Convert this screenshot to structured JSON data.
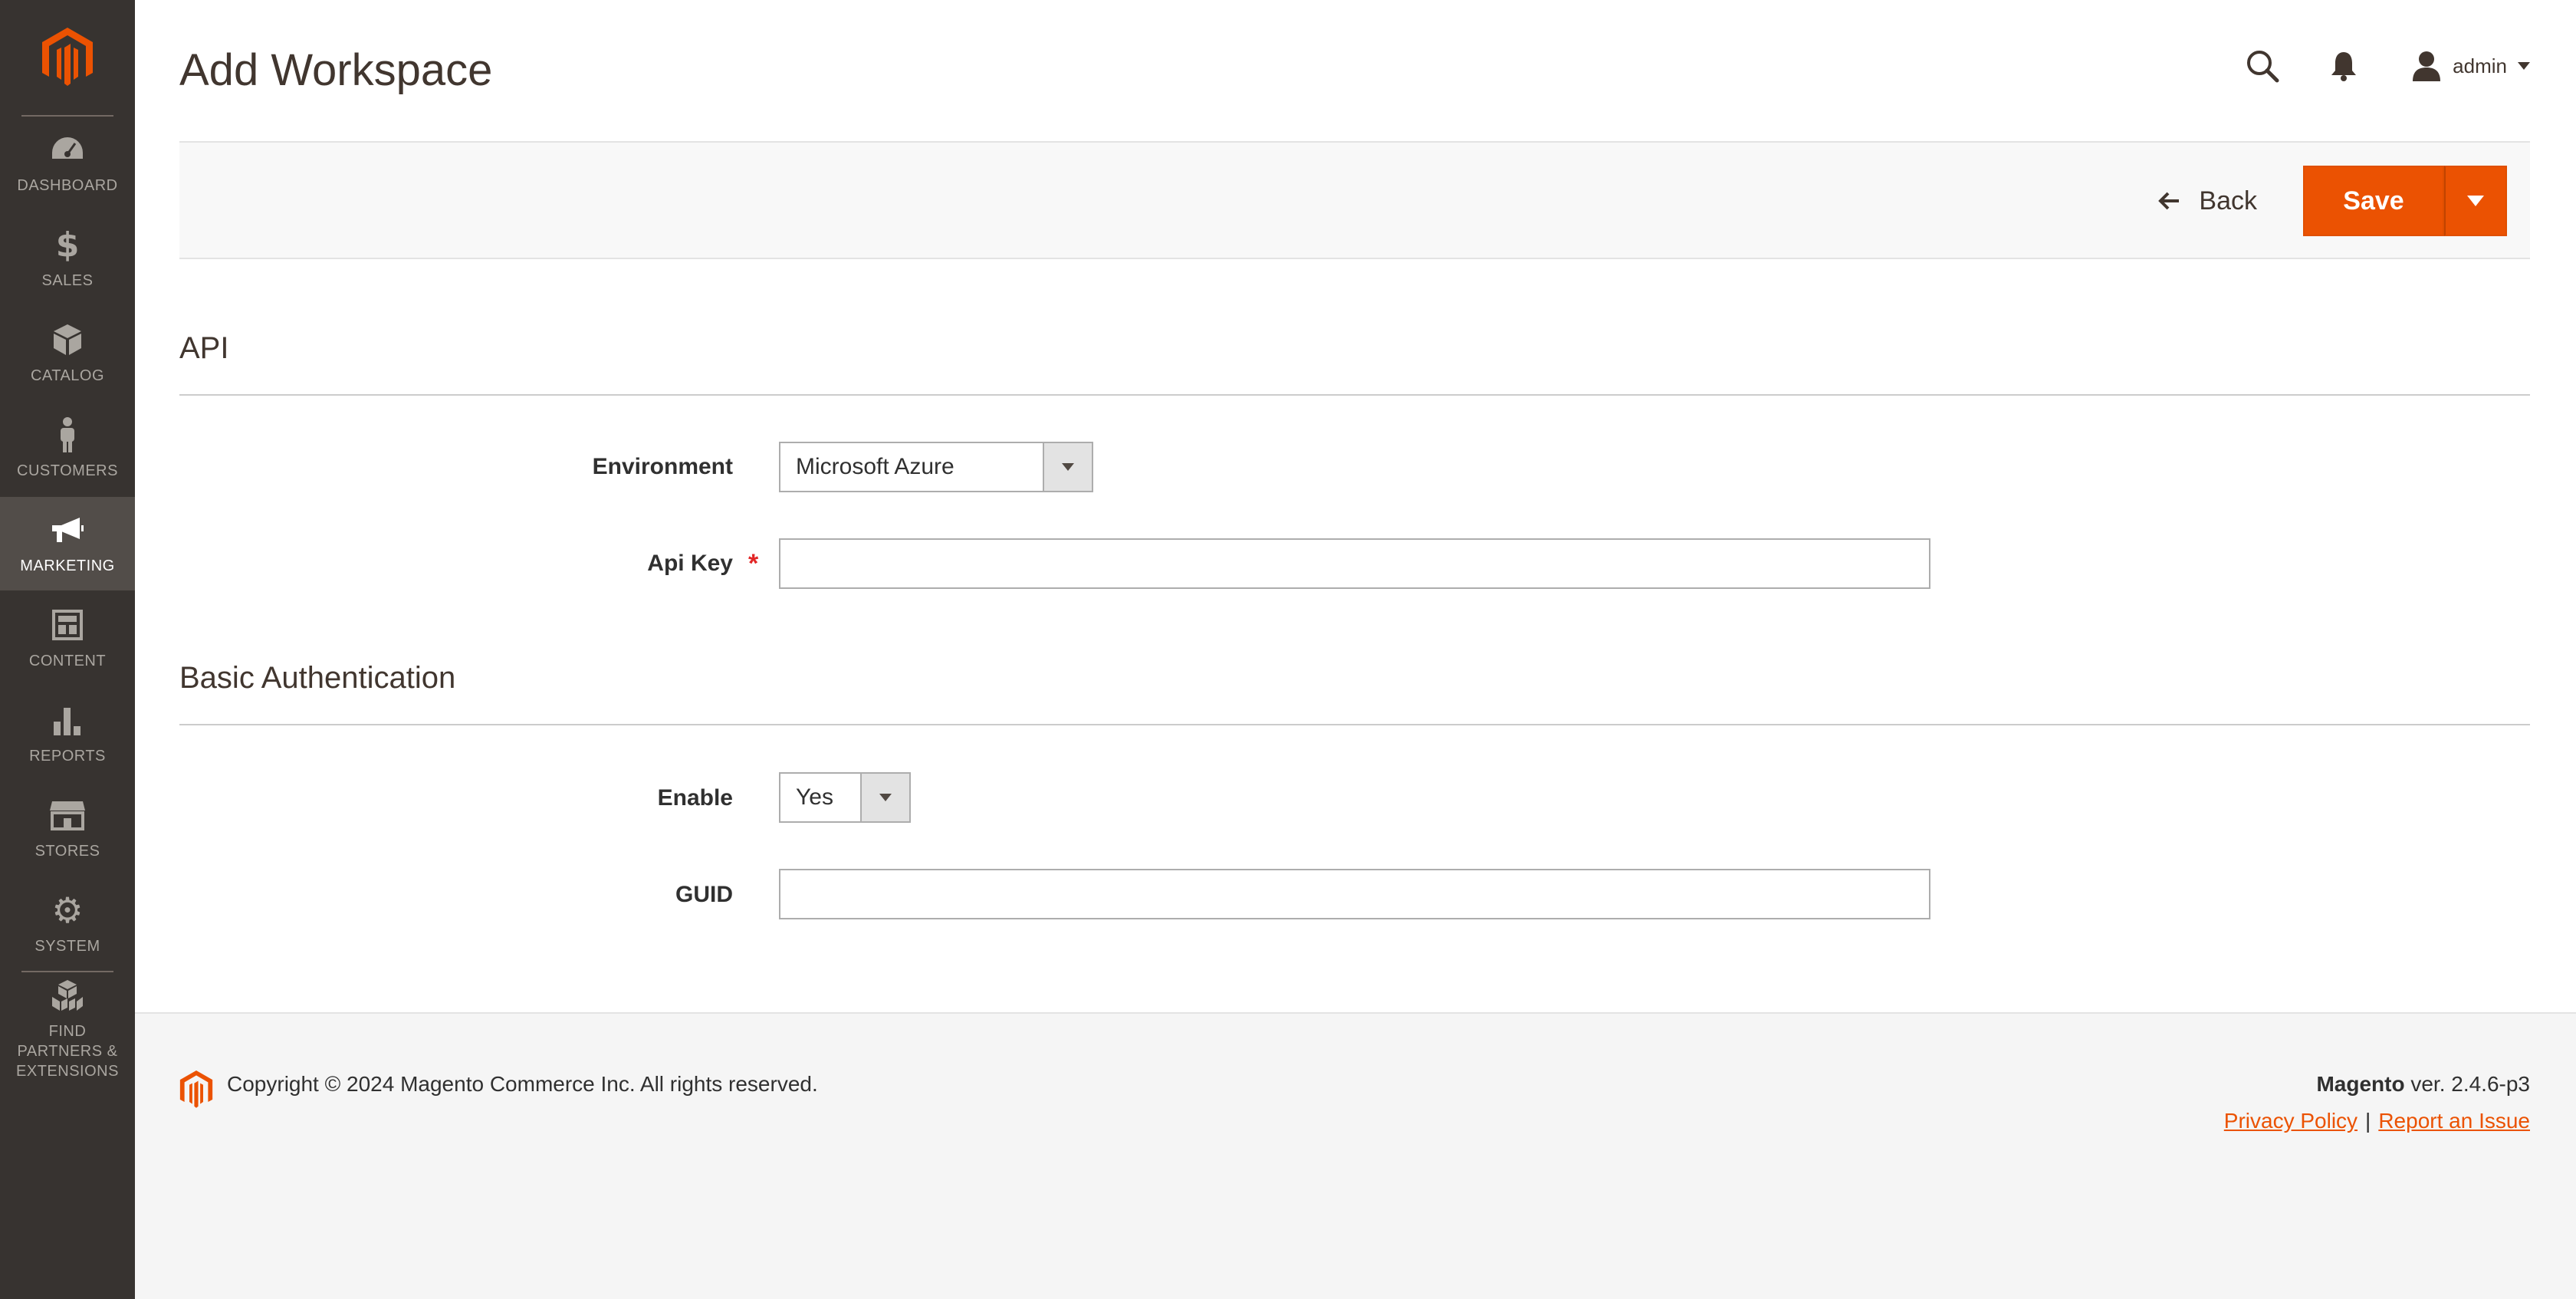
{
  "app": {
    "brand_color": "#eb5202"
  },
  "sidebar": {
    "items": [
      {
        "label": "DASHBOARD",
        "icon": "dashboard-gauge-icon"
      },
      {
        "label": "SALES",
        "icon": "dollar-icon"
      },
      {
        "label": "CATALOG",
        "icon": "box-icon"
      },
      {
        "label": "CUSTOMERS",
        "icon": "person-icon"
      },
      {
        "label": "MARKETING",
        "icon": "megaphone-icon",
        "active": true
      },
      {
        "label": "CONTENT",
        "icon": "layout-icon"
      },
      {
        "label": "REPORTS",
        "icon": "bar-chart-icon"
      },
      {
        "label": "STORES",
        "icon": "storefront-icon"
      },
      {
        "label": "SYSTEM",
        "icon": "gear-icon"
      },
      {
        "label": "FIND PARTNERS & EXTENSIONS",
        "icon": "cubes-icon"
      }
    ]
  },
  "header": {
    "title": "Add Workspace",
    "user": "admin"
  },
  "actions": {
    "back_label": "Back",
    "save_label": "Save"
  },
  "sections": {
    "api": {
      "title": "API",
      "environment_label": "Environment",
      "environment_value": "Microsoft Azure",
      "api_key_label": "Api Key",
      "api_key_value": "",
      "required_marker": "*"
    },
    "basic_auth": {
      "title": "Basic Authentication",
      "enable_label": "Enable",
      "enable_value": "Yes",
      "guid_label": "GUID",
      "guid_value": ""
    }
  },
  "footer": {
    "copyright": "Copyright © 2024 Magento Commerce Inc. All rights reserved.",
    "brand": "Magento",
    "version": "ver. 2.4.6-p3",
    "privacy_link": "Privacy Policy",
    "separator": "|",
    "report_link": "Report an Issue"
  }
}
